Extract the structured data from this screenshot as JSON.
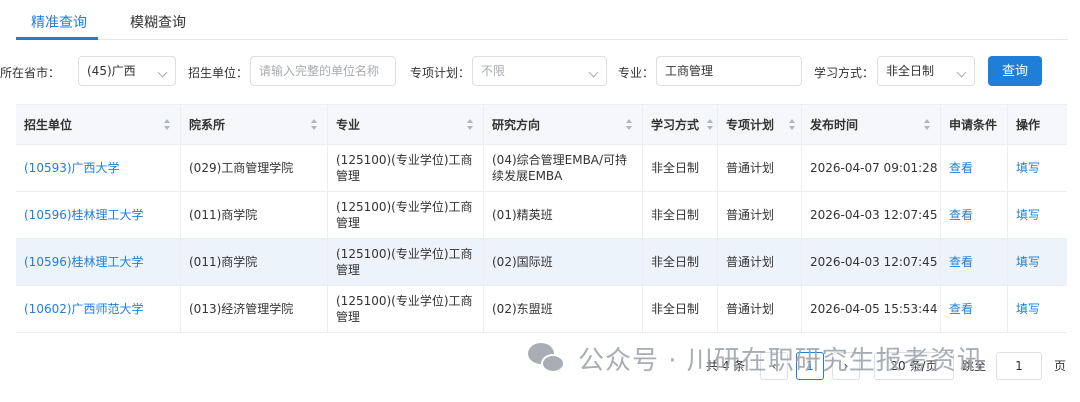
{
  "tabs": [
    {
      "label": "精准查询",
      "active": true
    },
    {
      "label": "模糊查询",
      "active": false
    }
  ],
  "filters": {
    "province_label": "所在省市：",
    "province_value": "(45)广西",
    "unit_label": "招生单位：",
    "unit_placeholder": "请输入完整的单位名称",
    "plan_label": "专项计划：",
    "plan_value": "不限",
    "major_label": "专业：",
    "major_value": "工商管理",
    "mode_label": "学习方式：",
    "mode_value": "非全日制",
    "query_button": "查询"
  },
  "table": {
    "headers": [
      "招生单位",
      "院系所",
      "专业",
      "研究方向",
      "学习方式",
      "专项计划",
      "发布时间",
      "申请条件",
      "操作"
    ],
    "rows": [
      [
        "(10593)广西大学",
        "(029)工商管理学院",
        "(125100)(专业学位)工商管理",
        "(04)综合管理EMBA/可持续发展EMBA",
        "非全日制",
        "普通计划",
        "2026-04-07 09:01:28",
        "查看",
        "填写"
      ],
      [
        "(10596)桂林理工大学",
        "(011)商学院",
        "(125100)(专业学位)工商管理",
        "(01)精英班",
        "非全日制",
        "普通计划",
        "2026-04-03 12:07:45",
        "查看",
        "填写"
      ],
      [
        "(10596)桂林理工大学",
        "(011)商学院",
        "(125100)(专业学位)工商管理",
        "(02)国际班",
        "非全日制",
        "普通计划",
        "2026-04-03 12:07:45",
        "查看",
        "填写"
      ],
      [
        "(10602)广西师范大学",
        "(013)经济管理学院",
        "(125100)(专业学位)工商管理",
        "(02)东盟班",
        "非全日制",
        "普通计划",
        "2026-04-05 15:53:44",
        "查看",
        "填写"
      ]
    ],
    "highlighted_row": 2
  },
  "pagination": {
    "total": "共 4 条",
    "current_page": "1",
    "page_size": "20 条/页",
    "goto_label": "跳至",
    "goto_value": "1",
    "page_suffix": "页"
  },
  "watermark": "公众号 · 川研在职研究生报考资讯",
  "colors": {
    "accent": "#1f7fd8",
    "header_bg": "#f5f7fa",
    "highlight_row": "#ecf3fb"
  }
}
